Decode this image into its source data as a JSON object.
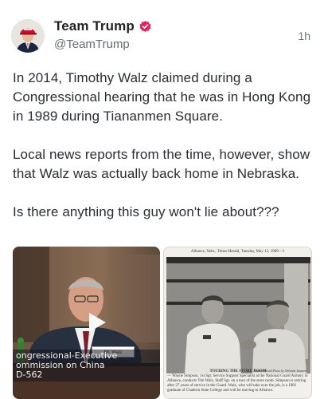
{
  "author": {
    "display_name": "Team Trump",
    "handle": "@TeamTrump",
    "verified": true,
    "avatar_icon": "profile-photo-red-cap",
    "verified_color": "#e0245e"
  },
  "timestamp": "1h",
  "post": {
    "paragraphs": [
      "In 2014, Timothy Walz claimed during a Congressional hearing that he was in Hong Kong in 1989 during Tiananmen Square.",
      "Local news reports from the time, however, show that Walz was actually back home in Nebraska.",
      "Is there anything this guy won't lie about???"
    ]
  },
  "media": {
    "video": {
      "caption_line1": "ongressional-Executive",
      "caption_line2": "ommission on China",
      "caption_line3": "D-562",
      "nameplate": "Mr. Walz",
      "play_icon": "play-icon"
    },
    "clipping": {
      "header": "Alliance, Nebr., Times-Herald, Tuesday, May 15, 1989—3",
      "caption_title": "TOURING THE STORE ROOM",
      "caption_body": "— Wayne Simpson, 1st Sgt. Service Support Specialist at the National Guard Armory in Alliance, conducts Tim Walz, Staff Sgt. on a tour of the store room. Simpson is retiring after 27 years of service in the Guard. Walz, who will take over the job, is a 1981 graduate of Chadron State College and will be moving to Alliance.",
      "credit": "Times-Herald Photo by Melinda Jannsen"
    }
  }
}
